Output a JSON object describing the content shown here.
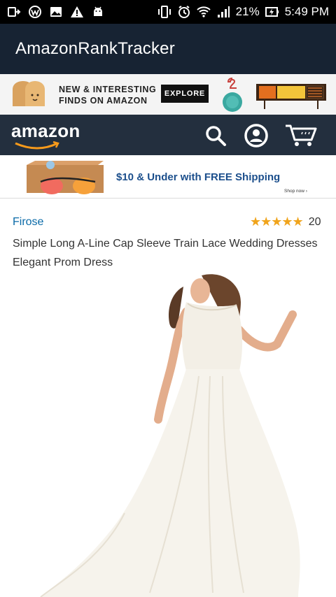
{
  "status_bar": {
    "battery": "21%",
    "time": "5:49 PM",
    "icons": [
      "usb-icon",
      "app-icon",
      "image-icon",
      "warning-icon",
      "android-icon",
      "vibrate-icon",
      "alarm-icon",
      "wifi-icon",
      "signal-icon",
      "battery-icon"
    ]
  },
  "app_bar": {
    "title": "AmazonRankTracker"
  },
  "promo_top": {
    "line1": "NEW & INTERESTING",
    "line2": "FINDS ON AMAZON",
    "explore_label": "EXPLORE"
  },
  "amazon_nav": {
    "logo_text": "amazon",
    "icons": [
      "search-icon",
      "account-icon",
      "cart-icon"
    ]
  },
  "promo_deal": {
    "text": "$10 & Under with FREE Shipping",
    "sub": "Shop now ›"
  },
  "product": {
    "brand": "Firose",
    "stars": "★★★★★",
    "review_count": "20",
    "title": "Simple Long A-Line Cap Sleeve Train Lace Wedding Dresses Elegant Prom Dress"
  },
  "colors": {
    "app_bar": "#172333",
    "amazon_nav": "#232f3e",
    "link": "#0a6aa8",
    "star": "#f0a41c"
  }
}
